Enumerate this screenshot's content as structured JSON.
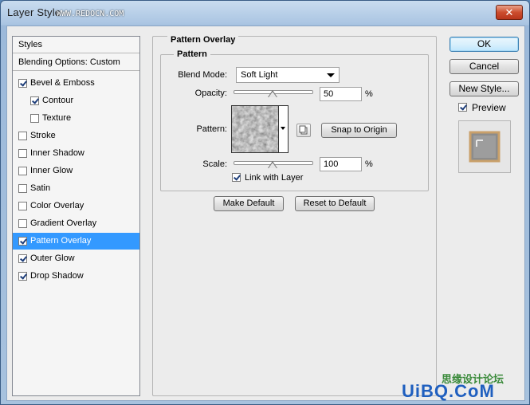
{
  "window": {
    "title": "Layer Style",
    "watermark_top": "WWW.REDOCN.COM",
    "close_label": "✕"
  },
  "styles_list": {
    "header": "Styles",
    "blending": "Blending Options: Custom",
    "items": [
      {
        "label": "Bevel & Emboss",
        "checked": true,
        "indent": false,
        "selected": false
      },
      {
        "label": "Contour",
        "checked": true,
        "indent": true,
        "selected": false
      },
      {
        "label": "Texture",
        "checked": false,
        "indent": true,
        "selected": false
      },
      {
        "label": "Stroke",
        "checked": false,
        "indent": false,
        "selected": false
      },
      {
        "label": "Inner Shadow",
        "checked": false,
        "indent": false,
        "selected": false
      },
      {
        "label": "Inner Glow",
        "checked": false,
        "indent": false,
        "selected": false
      },
      {
        "label": "Satin",
        "checked": false,
        "indent": false,
        "selected": false
      },
      {
        "label": "Color Overlay",
        "checked": false,
        "indent": false,
        "selected": false
      },
      {
        "label": "Gradient Overlay",
        "checked": false,
        "indent": false,
        "selected": false
      },
      {
        "label": "Pattern Overlay",
        "checked": true,
        "indent": false,
        "selected": true
      },
      {
        "label": "Outer Glow",
        "checked": true,
        "indent": false,
        "selected": false
      },
      {
        "label": "Drop Shadow",
        "checked": true,
        "indent": false,
        "selected": false
      }
    ]
  },
  "pattern_overlay": {
    "group_title": "Pattern Overlay",
    "sub_title": "Pattern",
    "blend_mode_label": "Blend Mode:",
    "blend_mode_value": "Soft Light",
    "opacity_label": "Opacity:",
    "opacity_value": "50",
    "opacity_unit": "%",
    "opacity_fraction": 0.5,
    "pattern_label": "Pattern:",
    "snap_label": "Snap to Origin",
    "scale_label": "Scale:",
    "scale_value": "100",
    "scale_unit": "%",
    "scale_fraction": 0.5,
    "link_label": "Link with Layer",
    "link_checked": true,
    "make_default_label": "Make Default",
    "reset_default_label": "Reset to Default"
  },
  "buttons": {
    "ok": "OK",
    "cancel": "Cancel",
    "new_style": "New Style...",
    "preview_label": "Preview",
    "preview_checked": true
  },
  "watermark_bottom": {
    "text1": "思缘设计论坛",
    "text2": "UiBQ.CoM"
  },
  "colors": {
    "selection": "#3399ff",
    "titlebar": "#a9c4e2",
    "close": "#cc4d2e"
  }
}
